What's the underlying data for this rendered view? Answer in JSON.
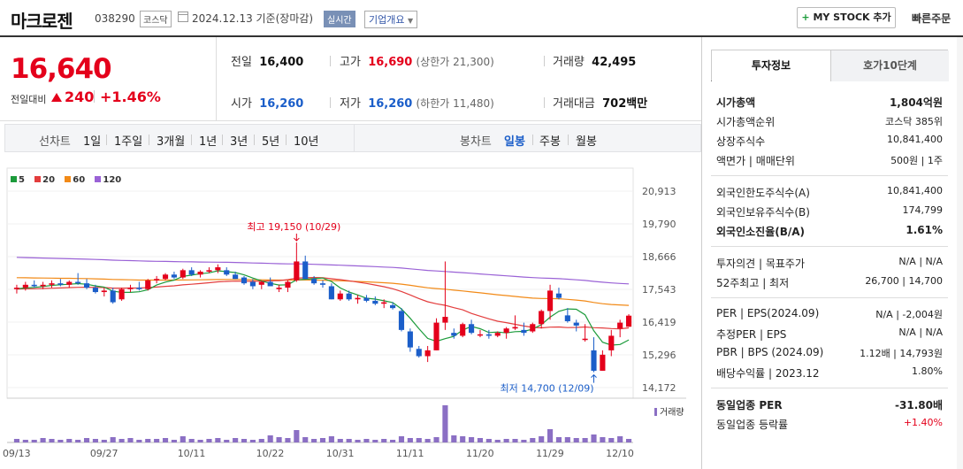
{
  "header": {
    "company": "마크로젠",
    "code": "038290",
    "market": "코스닥",
    "date": "2024.12.13  기준(장마감)",
    "realtime": "실시간",
    "corp_info": "기업개요",
    "mystock": "MY STOCK 추가",
    "quick_order": "빠른주문"
  },
  "price": {
    "current": "16,640",
    "change_label": "전일대비",
    "change": "240",
    "change_pct": "+1.46%"
  },
  "stats": {
    "prev_label": "전일",
    "prev": "16,400",
    "high_label": "고가",
    "high": "16,690",
    "upper_limit": "(상한가 21,300)",
    "volume_label": "거래량",
    "volume": "42,495",
    "open_label": "시가",
    "open": "16,260",
    "low_label": "저가",
    "low": "16,260",
    "lower_limit": "(하한가 11,480)",
    "amount_label": "거래대금",
    "amount": "702",
    "amount_unit": "백만"
  },
  "chart_tabs": {
    "line_label": "선차트",
    "line": [
      "1일",
      "1주일",
      "3개월",
      "1년",
      "3년",
      "5년",
      "10년"
    ],
    "candle_label": "봉차트",
    "candle": [
      "일봉",
      "주봉",
      "월봉"
    ],
    "active_candle": "일봉"
  },
  "colors": {
    "up": "#e4001b",
    "down": "#1b5ec9",
    "ma5": "#1c9b3b",
    "ma20": "#e33d3d",
    "ma60": "#f28a17",
    "ma120": "#9a62d6"
  },
  "chart_data": {
    "type": "candlestick",
    "legend": [
      "5",
      "20",
      "60",
      "120"
    ],
    "y_ticks": [
      "20,913",
      "19,790",
      "18,666",
      "17,543",
      "16,419",
      "15,296",
      "14,172"
    ],
    "ylim": [
      14172,
      20913
    ],
    "x_ticks": [
      "09/13",
      "09/27",
      "10/11",
      "10/22",
      "10/31",
      "11/11",
      "11/20",
      "11/29",
      "12/10"
    ],
    "volume_label": "거래량",
    "annotations": {
      "high": "최고 19,150 (10/29)",
      "low": "최저 14,700 (12/09)"
    },
    "candles": [
      [
        17550,
        17700,
        17400,
        17600
      ],
      [
        17600,
        17800,
        17500,
        17700
      ],
      [
        17700,
        17850,
        17600,
        17650
      ],
      [
        17650,
        17800,
        17550,
        17700
      ],
      [
        17700,
        17850,
        17600,
        17750
      ],
      [
        17750,
        17900,
        17650,
        17700
      ],
      [
        17700,
        17850,
        17600,
        17800
      ],
      [
        17800,
        18100,
        17700,
        17750
      ],
      [
        17750,
        17900,
        17550,
        17600
      ],
      [
        17600,
        17700,
        17400,
        17450
      ],
      [
        17450,
        17600,
        17300,
        17500
      ],
      [
        17500,
        17600,
        17050,
        17100
      ],
      [
        17200,
        17600,
        17150,
        17550
      ],
      [
        17550,
        17700,
        17450,
        17600
      ],
      [
        17600,
        17800,
        17500,
        17550
      ],
      [
        17550,
        17900,
        17500,
        17850
      ],
      [
        17850,
        18000,
        17750,
        17900
      ],
      [
        17900,
        18100,
        17850,
        18050
      ],
      [
        18050,
        18150,
        17900,
        17950
      ],
      [
        17950,
        18250,
        17900,
        18200
      ],
      [
        18200,
        18300,
        18000,
        18050
      ],
      [
        18050,
        18200,
        17950,
        18150
      ],
      [
        18150,
        18300,
        18100,
        18200
      ],
      [
        18200,
        18400,
        18100,
        18300
      ],
      [
        18200,
        18300,
        18000,
        18050
      ],
      [
        18050,
        18150,
        17900,
        17900
      ],
      [
        17950,
        18000,
        17700,
        17750
      ],
      [
        17800,
        17900,
        17550,
        17650
      ],
      [
        17700,
        17850,
        17550,
        17800
      ],
      [
        17800,
        17950,
        17700,
        17650
      ],
      [
        17550,
        17700,
        17450,
        17600
      ],
      [
        17600,
        17850,
        17450,
        17800
      ],
      [
        17850,
        19150,
        17800,
        18500
      ],
      [
        18500,
        18700,
        17900,
        17900
      ],
      [
        17900,
        18000,
        17700,
        17750
      ],
      [
        17750,
        17850,
        17600,
        17700
      ],
      [
        17650,
        17750,
        17200,
        17200
      ],
      [
        17200,
        17500,
        17150,
        17400
      ],
      [
        17400,
        17500,
        17150,
        17200
      ],
      [
        17200,
        17350,
        17050,
        17250
      ],
      [
        17250,
        17350,
        17100,
        17150
      ],
      [
        17150,
        17300,
        17000,
        17050
      ],
      [
        17050,
        17200,
        16900,
        17100
      ],
      [
        17000,
        17100,
        16850,
        16900
      ],
      [
        16800,
        16900,
        16100,
        16150
      ],
      [
        16100,
        16200,
        15400,
        15550
      ],
      [
        15500,
        15600,
        15200,
        15250
      ],
      [
        15250,
        15600,
        15050,
        15450
      ],
      [
        15450,
        16550,
        15450,
        16400
      ],
      [
        16400,
        18500,
        16150,
        16600
      ],
      [
        16050,
        16200,
        15850,
        15950
      ],
      [
        15950,
        16400,
        15900,
        16350
      ],
      [
        16350,
        16500,
        16000,
        16050
      ],
      [
        16000,
        16150,
        15900,
        16000
      ],
      [
        16000,
        16150,
        15850,
        15950
      ],
      [
        15950,
        16100,
        15900,
        16050
      ],
      [
        16050,
        16250,
        15850,
        16200
      ],
      [
        16200,
        16650,
        16150,
        16250
      ],
      [
        16150,
        16400,
        15950,
        16050
      ],
      [
        16100,
        16400,
        16050,
        16350
      ],
      [
        16350,
        16850,
        16200,
        16800
      ],
      [
        16800,
        17700,
        16500,
        17500
      ],
      [
        17400,
        17600,
        17200,
        17250
      ],
      [
        16650,
        16900,
        16400,
        16450
      ],
      [
        16400,
        16500,
        16100,
        16300
      ],
      [
        15850,
        16350,
        15750,
        15850
      ],
      [
        15450,
        15900,
        14700,
        14750
      ],
      [
        14750,
        15450,
        14750,
        15300
      ],
      [
        15450,
        16150,
        15250,
        15950
      ],
      [
        16200,
        16500,
        15900,
        16400
      ],
      [
        16260,
        16690,
        16260,
        16640
      ]
    ],
    "volumes": [
      4,
      3,
      3,
      5,
      4,
      3,
      4,
      3,
      5,
      4,
      3,
      6,
      4,
      5,
      3,
      4,
      4,
      5,
      3,
      7,
      4,
      3,
      4,
      5,
      3,
      5,
      4,
      3,
      4,
      8,
      6,
      5,
      14,
      6,
      4,
      5,
      7,
      4,
      4,
      3,
      4,
      3,
      4,
      3,
      7,
      5,
      5,
      4,
      6,
      42,
      8,
      7,
      6,
      5,
      4,
      3,
      4,
      4,
      3,
      5,
      7,
      15,
      6,
      6,
      5,
      5,
      9,
      6,
      5,
      7,
      4
    ]
  },
  "right_panel": {
    "tabs": [
      "투자정보",
      "호가10단계"
    ],
    "rows1": [
      {
        "k": "시가총액",
        "v": "1,804억원"
      },
      {
        "k": "시가총액순위",
        "v": "코스닥 385위"
      },
      {
        "k": "상장주식수",
        "v": "10,841,400"
      },
      {
        "k": "액면가  |  매매단위",
        "v": "500원  |  1주"
      }
    ],
    "rows2": [
      {
        "k": "외국인한도주식수(A)",
        "v": "10,841,400"
      },
      {
        "k": "외국인보유주식수(B)",
        "v": "174,799"
      },
      {
        "k": "외국인소진율(B/A)",
        "v": "1.61%"
      }
    ],
    "rows3": [
      {
        "k": "투자의견  |  목표주가",
        "v": "N/A  |  N/A"
      },
      {
        "k": "52주최고  |  최저",
        "v": "26,700  |  14,700"
      }
    ],
    "rows4": [
      {
        "k": "PER  |  EPS(2024.09)",
        "v": "N/A  |  -2,004원"
      },
      {
        "k": "추정PER  |  EPS",
        "v": "N/A  |  N/A"
      },
      {
        "k": "PBR  |  BPS (2024.09)",
        "v": "1.12배  |  14,793원"
      },
      {
        "k": "배당수익률  |  2023.12",
        "v": "1.80%"
      }
    ],
    "rows5": [
      {
        "k": "동일업종 PER",
        "v": "-31.80배"
      },
      {
        "k": "동일업종 등락률",
        "v": "+1.40%"
      }
    ]
  }
}
